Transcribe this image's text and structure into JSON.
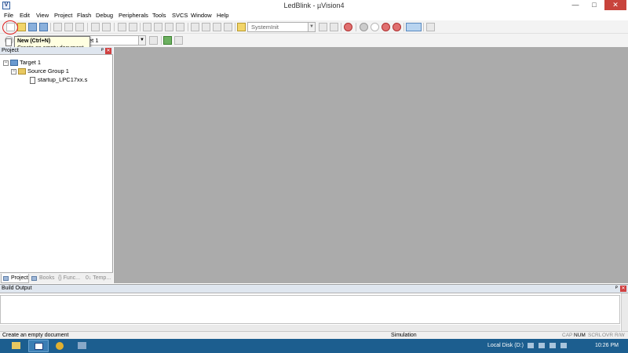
{
  "window": {
    "title": "LedBlink - µVision4",
    "app_icon_glyph": "V",
    "minimize": "—",
    "maximize": "□",
    "close": "✕"
  },
  "menu": [
    "File",
    "Edit",
    "View",
    "Project",
    "Flash",
    "Debug",
    "Peripherals",
    "Tools",
    "SVCS",
    "Window",
    "Help"
  ],
  "toolbar": {
    "find_combo_value": "SystemInit",
    "target_combo_value": "et 1"
  },
  "tooltip": {
    "title": "New (Ctrl+N)",
    "description": "Create an empty document"
  },
  "project_panel": {
    "title": "Project",
    "tree": {
      "target": "Target 1",
      "group": "Source Group 1",
      "file": "startup_LPC17xx.s"
    },
    "tabs": [
      "Project",
      "Books",
      "{} Func...",
      "0↓ Temp..."
    ]
  },
  "build_output": {
    "title": "Build Output"
  },
  "statusbar": {
    "message": "Create an empty document",
    "mode": "Simulation",
    "keys": [
      "CAP",
      "NUM",
      "SCRL",
      "OVR",
      "R/W"
    ]
  },
  "taskbar": {
    "drive": "Local Disk (D:)",
    "time": "10:26 PM"
  },
  "colors": {
    "editor_bg": "#ababab",
    "taskbar": "#1c5e8f",
    "highlight_circle": "#e02020"
  }
}
